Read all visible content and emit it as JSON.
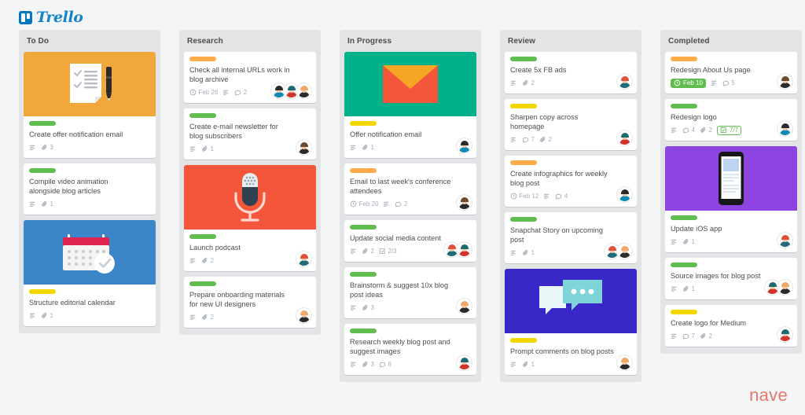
{
  "brand": {
    "name": "Trello",
    "mark": "trello-board-icon",
    "color": "#0079bf"
  },
  "footer_brand": {
    "name": "nave",
    "color": "#e07a6a"
  },
  "label_colors": {
    "green": "#61bd4f",
    "yellow": "#f2d600",
    "orange": "#ffab4a"
  },
  "columns": [
    {
      "title": "To Do",
      "cards": [
        {
          "cover": "checklist-pen-illustration",
          "cover_color": "#f2a73b",
          "label": "green",
          "title": "Create offer notification email",
          "meta": [
            {
              "icon": "description-icon"
            },
            {
              "icon": "attachment-icon",
              "text": "3"
            }
          ],
          "avatars": []
        },
        {
          "label": "green",
          "title": "Compile video animation alongside blog articles",
          "meta": [
            {
              "icon": "description-icon"
            },
            {
              "icon": "attachment-icon",
              "text": "1"
            }
          ],
          "avatars": []
        },
        {
          "cover": "calendar-illustration",
          "cover_color": "#3b85c8",
          "label": "yellow",
          "title": "Structure editorial calendar",
          "meta": [
            {
              "icon": "description-icon"
            },
            {
              "icon": "attachment-icon",
              "text": "1"
            }
          ],
          "avatars": []
        }
      ]
    },
    {
      "title": "Research",
      "cards": [
        {
          "label": "orange",
          "title": "Check all internal URLs work in blog archive",
          "meta": [
            {
              "icon": "clock-icon",
              "text": "Feb 26"
            },
            {
              "icon": "description-icon"
            },
            {
              "icon": "comment-icon",
              "text": "2"
            }
          ],
          "avatars": [
            {
              "hair": "#2b2b2b",
              "body": "#0e8ab5"
            },
            {
              "hair": "#1c6b73",
              "body": "#d0342c"
            },
            {
              "hair": "#f0a868",
              "body": "#2b2b2b"
            }
          ],
          "avatars_inline": true
        },
        {
          "label": "green",
          "title": "Create e-mail newsletter for blog subscribers",
          "meta": [
            {
              "icon": "description-icon"
            },
            {
              "icon": "attachment-icon",
              "text": "1"
            }
          ],
          "avatars": [
            {
              "hair": "#6b4a2f",
              "body": "#2b2b2b"
            }
          ]
        },
        {
          "cover": "microphone-illustration",
          "cover_color": "#f4563c",
          "label": "green",
          "title": "Launch podcast",
          "meta": [
            {
              "icon": "description-icon"
            },
            {
              "icon": "attachment-icon",
              "text": "2"
            }
          ],
          "avatars": [
            {
              "hair": "#e2503a",
              "body": "#1f6b7a"
            }
          ]
        },
        {
          "label": "green",
          "title": "Prepare onboarding materials for new UI designers",
          "meta": [
            {
              "icon": "description-icon"
            },
            {
              "icon": "attachment-icon",
              "text": "2"
            }
          ],
          "avatars": [
            {
              "hair": "#f0a868",
              "body": "#2b2b2b"
            }
          ]
        }
      ]
    },
    {
      "title": "In Progress",
      "cards": [
        {
          "cover": "envelope-illustration",
          "cover_color": "#00b189",
          "label": "yellow",
          "title": "Offer notification email",
          "meta": [
            {
              "icon": "description-icon"
            },
            {
              "icon": "attachment-icon",
              "text": "1"
            }
          ],
          "avatars": [
            {
              "hair": "#2b2b2b",
              "body": "#0e8ab5"
            }
          ]
        },
        {
          "label": "orange",
          "title": "Email to last week's conference attendees",
          "meta": [
            {
              "icon": "clock-icon",
              "text": "Feb 20"
            },
            {
              "icon": "description-icon"
            },
            {
              "icon": "comment-icon",
              "text": "2"
            }
          ],
          "avatars": [
            {
              "hair": "#6b4a2f",
              "body": "#2b2b2b"
            }
          ]
        },
        {
          "label": "green",
          "title": "Update social media content",
          "meta": [
            {
              "icon": "description-icon"
            },
            {
              "icon": "attachment-icon",
              "text": "2"
            },
            {
              "icon": "checklist-icon",
              "text": "2/3"
            }
          ],
          "avatars": [
            {
              "hair": "#e2503a",
              "body": "#1f6b7a"
            },
            {
              "hair": "#1c6b73",
              "body": "#d0342c"
            }
          ]
        },
        {
          "label": "green",
          "title": "Brainstorm & suggest 10x blog post ideas",
          "meta": [
            {
              "icon": "description-icon"
            },
            {
              "icon": "attachment-icon",
              "text": "3"
            }
          ],
          "avatars": [
            {
              "hair": "#f0a868",
              "body": "#2b2b2b"
            }
          ]
        },
        {
          "label": "green",
          "title": "Research weekly blog post and suggest images",
          "meta": [
            {
              "icon": "description-icon"
            },
            {
              "icon": "attachment-icon",
              "text": "3"
            },
            {
              "icon": "comment-icon",
              "text": "6"
            }
          ],
          "avatars": [
            {
              "hair": "#1c6b73",
              "body": "#d0342c"
            }
          ]
        }
      ]
    },
    {
      "title": "Review",
      "cards": [
        {
          "label": "green",
          "title": "Create 5x FB ads",
          "meta": [
            {
              "icon": "description-icon"
            },
            {
              "icon": "attachment-icon",
              "text": "2"
            }
          ],
          "avatars": [
            {
              "hair": "#e2503a",
              "body": "#1f6b7a"
            }
          ]
        },
        {
          "label": "yellow",
          "title": "Sharpen copy across homepage",
          "meta": [
            {
              "icon": "description-icon"
            },
            {
              "icon": "comment-icon",
              "text": "7"
            },
            {
              "icon": "attachment-icon",
              "text": "2"
            }
          ],
          "avatars": [
            {
              "hair": "#1c6b73",
              "body": "#d0342c"
            }
          ]
        },
        {
          "label": "orange",
          "title": "Create infographics for weekly blog post",
          "meta": [
            {
              "icon": "clock-icon",
              "text": "Feb 12"
            },
            {
              "icon": "description-icon"
            },
            {
              "icon": "comment-icon",
              "text": "4"
            }
          ],
          "avatars": [
            {
              "hair": "#2b2b2b",
              "body": "#0e8ab5"
            }
          ]
        },
        {
          "label": "green",
          "title": "Snapchat Story on upcoming post",
          "meta": [
            {
              "icon": "description-icon"
            },
            {
              "icon": "attachment-icon",
              "text": "1"
            }
          ],
          "avatars": [
            {
              "hair": "#e2503a",
              "body": "#1f6b7a"
            },
            {
              "hair": "#f0a868",
              "body": "#2b2b2b"
            }
          ]
        },
        {
          "cover": "chat-bubbles-illustration",
          "cover_color": "#3a27c8",
          "label": "yellow",
          "title": "Prompt comments on blog posts",
          "meta": [
            {
              "icon": "description-icon"
            },
            {
              "icon": "attachment-icon",
              "text": "1"
            }
          ],
          "avatars": [
            {
              "hair": "#f0a868",
              "body": "#2b2b2b"
            }
          ]
        }
      ]
    },
    {
      "title": "Completed",
      "cards": [
        {
          "label": "orange",
          "title": "Redesign About Us page",
          "meta": [
            {
              "icon": "clock-icon",
              "text": "Feb 10",
              "style": "badge-green"
            },
            {
              "icon": "description-icon"
            },
            {
              "icon": "comment-icon",
              "text": "5"
            }
          ],
          "avatars": [
            {
              "hair": "#6b4a2f",
              "body": "#2b2b2b"
            }
          ]
        },
        {
          "label": "green",
          "title": "Redesign logo",
          "meta": [
            {
              "icon": "description-icon"
            },
            {
              "icon": "comment-icon",
              "text": "4"
            },
            {
              "icon": "attachment-icon",
              "text": "2"
            },
            {
              "icon": "checklist-icon",
              "text": "7/7",
              "style": "badge-green-outline"
            }
          ],
          "avatars": [
            {
              "hair": "#2b2b2b",
              "body": "#0e8ab5"
            }
          ]
        },
        {
          "cover": "smartphone-illustration",
          "cover_color": "#8e44e0",
          "label": "green",
          "title": "Update iOS app",
          "meta": [
            {
              "icon": "description-icon"
            },
            {
              "icon": "attachment-icon",
              "text": "1"
            }
          ],
          "avatars": [
            {
              "hair": "#e2503a",
              "body": "#1f6b7a"
            }
          ]
        },
        {
          "label": "green",
          "title": "Source images for blog post",
          "meta": [
            {
              "icon": "description-icon"
            },
            {
              "icon": "attachment-icon",
              "text": "1"
            }
          ],
          "avatars": [
            {
              "hair": "#1c6b73",
              "body": "#d0342c"
            },
            {
              "hair": "#f0a868",
              "body": "#2b2b2b"
            }
          ]
        },
        {
          "label": "yellow",
          "title": "Create logo for Medium",
          "meta": [
            {
              "icon": "description-icon"
            },
            {
              "icon": "comment-icon",
              "text": "7"
            },
            {
              "icon": "attachment-icon",
              "text": "2"
            }
          ],
          "avatars": [
            {
              "hair": "#1c6b73",
              "body": "#d0342c"
            }
          ]
        }
      ]
    }
  ]
}
